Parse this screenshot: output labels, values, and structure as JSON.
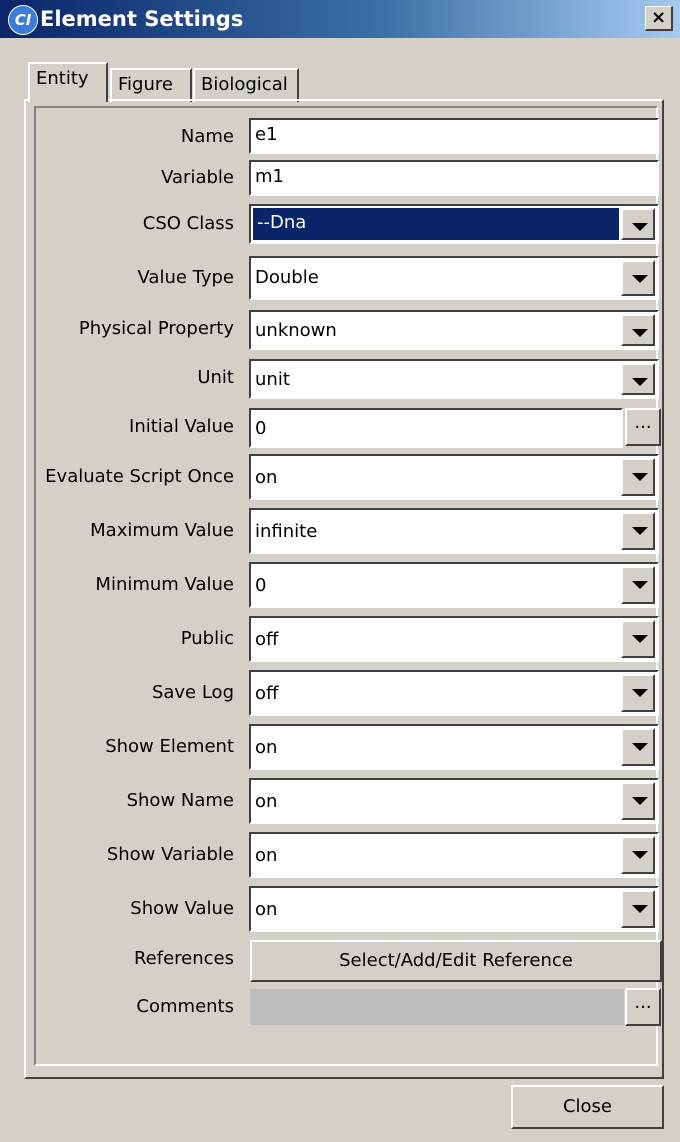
{
  "window": {
    "title": "Element Settings",
    "icon_text": "CI",
    "close_glyph": "×"
  },
  "tabs": [
    {
      "label": "Entity",
      "active": true
    },
    {
      "label": "Figure",
      "active": false
    },
    {
      "label": "Biological",
      "active": false
    }
  ],
  "fields": {
    "name": {
      "label": "Name",
      "value": "e1"
    },
    "variable": {
      "label": "Variable",
      "value": "m1"
    },
    "cso_class": {
      "label": "CSO Class",
      "value": "--Dna"
    },
    "value_type": {
      "label": "Value Type",
      "value": "Double"
    },
    "physical_property": {
      "label": "Physical Property",
      "value": "unknown"
    },
    "unit": {
      "label": "Unit",
      "value": "unit"
    },
    "initial_value": {
      "label": "Initial Value",
      "value": "0"
    },
    "evaluate_script_once": {
      "label": "Evaluate Script Once",
      "value": "on"
    },
    "maximum_value": {
      "label": "Maximum Value",
      "value": "infinite"
    },
    "minimum_value": {
      "label": "Minimum Value",
      "value": "0"
    },
    "public": {
      "label": "Public",
      "value": "off"
    },
    "save_log": {
      "label": "Save Log",
      "value": "off"
    },
    "show_element": {
      "label": "Show Element",
      "value": "on"
    },
    "show_name": {
      "label": "Show Name",
      "value": "on"
    },
    "show_variable": {
      "label": "Show Variable",
      "value": "on"
    },
    "show_value": {
      "label": "Show Value",
      "value": "on"
    },
    "references": {
      "label": "References",
      "button_label": "Select/Add/Edit Reference"
    },
    "comments": {
      "label": "Comments",
      "value": ""
    }
  },
  "ellipsis_label": "...",
  "close_button_label": "Close",
  "colors": {
    "selection": "#0a246a",
    "face": "#d4d0c8"
  }
}
